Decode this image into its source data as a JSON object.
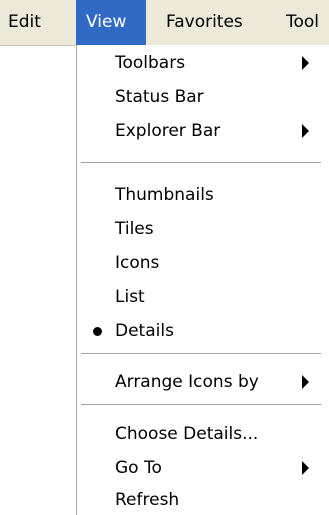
{
  "menubar": {
    "items": [
      "Edit",
      "View",
      "Favorites",
      "Tool"
    ]
  },
  "view_menu": {
    "items": [
      {
        "label": "Toolbars",
        "submenu": true
      },
      {
        "label": "Status Bar"
      },
      {
        "label": "Explorer Bar",
        "submenu": true
      },
      {
        "label": "Thumbnails"
      },
      {
        "label": "Tiles"
      },
      {
        "label": "Icons"
      },
      {
        "label": "List"
      },
      {
        "label": "Details",
        "selected": true
      },
      {
        "label": "Arrange Icons by",
        "submenu": true
      },
      {
        "label": "Choose Details..."
      },
      {
        "label": "Go To",
        "submenu": true
      },
      {
        "label": "Refresh"
      }
    ]
  },
  "colors": {
    "menubar_bg": "#ece9d8",
    "highlight": "#316ac5"
  },
  "icons": {
    "submenu": "submenu-arrow-icon",
    "selected": "radio-bullet-icon"
  }
}
